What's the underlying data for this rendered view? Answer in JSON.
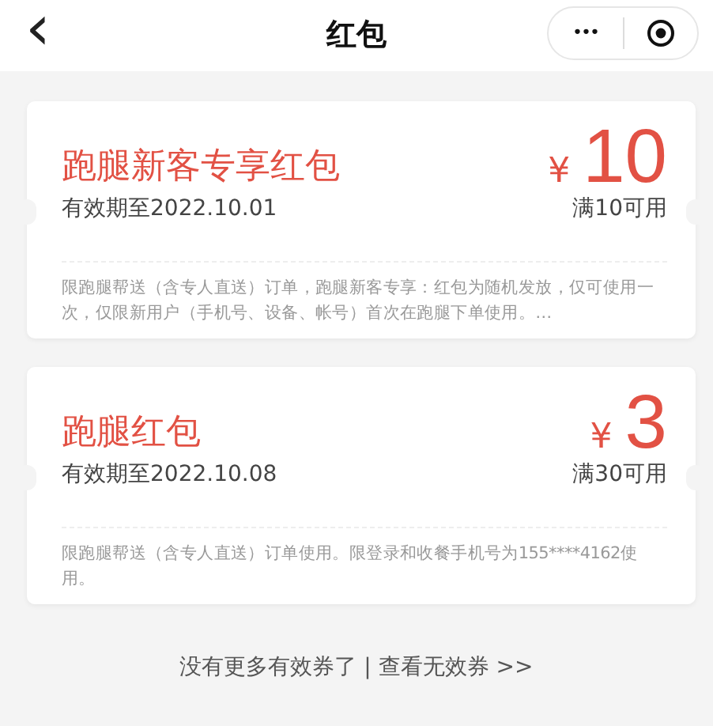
{
  "header": {
    "back": "‹",
    "title": "红包",
    "more": "•••"
  },
  "coupons": [
    {
      "title": "跑腿新客专享红包",
      "expiry": "有效期至2022.10.01",
      "currency": "¥",
      "amount": "10",
      "condition": "满10可用",
      "description": "限跑腿帮送（含专人直送）订单，跑腿新客专享：红包为随机发放，仅可使用一次，仅限新用户（手机号、设备、帐号）首次在跑腿下单使用。…"
    },
    {
      "title": "跑腿红包",
      "expiry": "有效期至2022.10.08",
      "currency": "¥",
      "amount": "3",
      "condition": "满30可用",
      "description": "限跑腿帮送（含专人直送）订单使用。限登录和收餐手机号为155****4162使用。"
    }
  ],
  "footer": {
    "note": "没有更多有效券了",
    "separator": "|",
    "link": "查看无效券 >>"
  }
}
